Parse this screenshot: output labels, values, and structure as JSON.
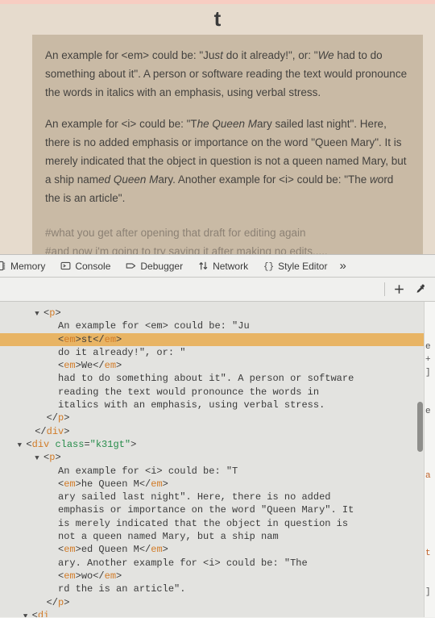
{
  "page": {
    "title": "t",
    "top_border_color": "#f7cdc2",
    "background_color": "#e6dbcd",
    "content_block_color": "#c9baa5",
    "paragraphs": [
      {
        "id": "p1",
        "segments": [
          {
            "text": "An example for <em> could be: \"Ju",
            "italic": false
          },
          {
            "text": "st",
            "italic": true
          },
          {
            "text": " do it already!\", or: \"",
            "italic": false
          },
          {
            "text": "We",
            "italic": true
          },
          {
            "text": " had to do something about it\". A person or software reading the text would pronounce the words in italics with an emphasis, using verbal stress.",
            "italic": false
          }
        ]
      },
      {
        "id": "p2",
        "segments": [
          {
            "text": "An example for <i> could be: \"T",
            "italic": false
          },
          {
            "text": "he Queen M",
            "italic": true
          },
          {
            "text": "ary sailed last night\". Here, there is no added emphasis or importance on the word \"Queen Mary\". It is merely indicated that the object in question is not a queen named Mary, but a ship nam",
            "italic": false
          },
          {
            "text": "ed Queen M",
            "italic": true
          },
          {
            "text": "ary. Another example for <i> could be: \"The ",
            "italic": false
          },
          {
            "text": "wo",
            "italic": true
          },
          {
            "text": "rd the is an article\".",
            "italic": false
          }
        ]
      }
    ],
    "hash_lines": [
      "#what you get after opening that draft for editing again",
      "#and now i'm going to try saving it after making no edits....."
    ]
  },
  "devtools": {
    "tabs": [
      {
        "label": "Memory",
        "icon": "memory-icon",
        "clipped": true
      },
      {
        "label": "Console",
        "icon": "console-icon",
        "clipped": false
      },
      {
        "label": "Debugger",
        "icon": "debugger-icon",
        "clipped": false
      },
      {
        "label": "Network",
        "icon": "network-icon",
        "clipped": false
      },
      {
        "label": "Style Editor",
        "icon": "style-editor-icon",
        "clipped": false
      }
    ],
    "more_tabs_label": "»",
    "toolbar": {
      "add_rule_label": "+",
      "eyedropper_label": "eyedropper"
    },
    "selected_color": "#e8b464",
    "markup_lines": [
      {
        "indent": 8,
        "twisty": true,
        "parts": [
          {
            "t": "punct",
            "v": "<"
          },
          {
            "t": "tag",
            "v": "p"
          },
          {
            "t": "punct",
            "v": ">"
          }
        ]
      },
      {
        "indent": 10,
        "twisty": false,
        "parts": [
          {
            "t": "txt",
            "v": "An example for <em> could be: \"Ju"
          }
        ]
      },
      {
        "indent": 10,
        "twisty": false,
        "selected": true,
        "parts": [
          {
            "t": "punct",
            "v": "<"
          },
          {
            "t": "tag",
            "v": "em"
          },
          {
            "t": "punct",
            "v": ">"
          },
          {
            "t": "txt",
            "v": "st"
          },
          {
            "t": "punct",
            "v": "</"
          },
          {
            "t": "tag",
            "v": "em"
          },
          {
            "t": "punct",
            "v": ">"
          }
        ]
      },
      {
        "indent": 10,
        "twisty": false,
        "parts": [
          {
            "t": "txt",
            "v": "do it already!\", or: \""
          }
        ]
      },
      {
        "indent": 10,
        "twisty": false,
        "parts": [
          {
            "t": "punct",
            "v": "<"
          },
          {
            "t": "tag",
            "v": "em"
          },
          {
            "t": "punct",
            "v": ">"
          },
          {
            "t": "txt",
            "v": "We"
          },
          {
            "t": "punct",
            "v": "</"
          },
          {
            "t": "tag",
            "v": "em"
          },
          {
            "t": "punct",
            "v": ">"
          }
        ]
      },
      {
        "indent": 10,
        "twisty": false,
        "parts": [
          {
            "t": "txt",
            "v": "had to do something about it\". A person or software"
          }
        ]
      },
      {
        "indent": 10,
        "twisty": false,
        "parts": [
          {
            "t": "txt",
            "v": "reading the text would pronounce the words in"
          }
        ]
      },
      {
        "indent": 10,
        "twisty": false,
        "parts": [
          {
            "t": "txt",
            "v": "italics with an emphasis, using verbal stress."
          }
        ]
      },
      {
        "indent": 8,
        "twisty": false,
        "parts": [
          {
            "t": "punct",
            "v": "</"
          },
          {
            "t": "tag",
            "v": "p"
          },
          {
            "t": "punct",
            "v": ">"
          }
        ]
      },
      {
        "indent": 6,
        "twisty": false,
        "parts": [
          {
            "t": "punct",
            "v": "</"
          },
          {
            "t": "tag",
            "v": "div"
          },
          {
            "t": "punct",
            "v": ">"
          }
        ]
      },
      {
        "indent": 5,
        "twisty": true,
        "parts": [
          {
            "t": "punct",
            "v": "<"
          },
          {
            "t": "tag",
            "v": "div"
          },
          {
            "t": "txt",
            "v": " "
          },
          {
            "t": "attr",
            "v": "class"
          },
          {
            "t": "punct",
            "v": "="
          },
          {
            "t": "attrval",
            "v": "\"k31gt\""
          },
          {
            "t": "punct",
            "v": ">"
          }
        ]
      },
      {
        "indent": 8,
        "twisty": true,
        "parts": [
          {
            "t": "punct",
            "v": "<"
          },
          {
            "t": "tag",
            "v": "p"
          },
          {
            "t": "punct",
            "v": ">"
          }
        ]
      },
      {
        "indent": 10,
        "twisty": false,
        "parts": [
          {
            "t": "txt",
            "v": "An example for <i> could be: \"T"
          }
        ]
      },
      {
        "indent": 10,
        "twisty": false,
        "parts": [
          {
            "t": "punct",
            "v": "<"
          },
          {
            "t": "tag",
            "v": "em"
          },
          {
            "t": "punct",
            "v": ">"
          },
          {
            "t": "txt",
            "v": "he Queen M"
          },
          {
            "t": "punct",
            "v": "</"
          },
          {
            "t": "tag",
            "v": "em"
          },
          {
            "t": "punct",
            "v": ">"
          }
        ]
      },
      {
        "indent": 10,
        "twisty": false,
        "parts": [
          {
            "t": "txt",
            "v": "ary sailed last night\". Here, there is no added"
          }
        ]
      },
      {
        "indent": 10,
        "twisty": false,
        "parts": [
          {
            "t": "txt",
            "v": "emphasis or importance on the word \"Queen Mary\". It"
          }
        ]
      },
      {
        "indent": 10,
        "twisty": false,
        "parts": [
          {
            "t": "txt",
            "v": "is merely indicated that the object in question is"
          }
        ]
      },
      {
        "indent": 10,
        "twisty": false,
        "parts": [
          {
            "t": "txt",
            "v": "not a queen named Mary, but a ship nam"
          }
        ]
      },
      {
        "indent": 10,
        "twisty": false,
        "parts": [
          {
            "t": "punct",
            "v": "<"
          },
          {
            "t": "tag",
            "v": "em"
          },
          {
            "t": "punct",
            "v": ">"
          },
          {
            "t": "txt",
            "v": "ed Queen M"
          },
          {
            "t": "punct",
            "v": "</"
          },
          {
            "t": "tag",
            "v": "em"
          },
          {
            "t": "punct",
            "v": ">"
          }
        ]
      },
      {
        "indent": 10,
        "twisty": false,
        "parts": [
          {
            "t": "txt",
            "v": "ary. Another example for <i> could be: \"The"
          }
        ]
      },
      {
        "indent": 10,
        "twisty": false,
        "parts": [
          {
            "t": "punct",
            "v": "<"
          },
          {
            "t": "tag",
            "v": "em"
          },
          {
            "t": "punct",
            "v": ">"
          },
          {
            "t": "txt",
            "v": "wo"
          },
          {
            "t": "punct",
            "v": "</"
          },
          {
            "t": "tag",
            "v": "em"
          },
          {
            "t": "punct",
            "v": ">"
          }
        ]
      },
      {
        "indent": 10,
        "twisty": false,
        "parts": [
          {
            "t": "txt",
            "v": "rd the is an article\"."
          }
        ]
      },
      {
        "indent": 8,
        "twisty": false,
        "parts": [
          {
            "t": "punct",
            "v": "</"
          },
          {
            "t": "tag",
            "v": "p"
          },
          {
            "t": "punct",
            "v": ">"
          }
        ]
      },
      {
        "indent": 6,
        "twisty": true,
        "parts": [
          {
            "t": "punct",
            "v": "<"
          },
          {
            "t": "tag",
            "v": "di"
          }
        ]
      }
    ],
    "rules_sliver_lines": [
      {
        "text": "",
        "orange": false
      },
      {
        "text": "",
        "orange": false
      },
      {
        "text": "",
        "orange": false
      },
      {
        "text": "e",
        "orange": false
      },
      {
        "text": "+",
        "orange": false
      },
      {
        "text": "]",
        "orange": false
      },
      {
        "text": "",
        "orange": false
      },
      {
        "text": "",
        "orange": false
      },
      {
        "text": "e",
        "orange": false
      },
      {
        "text": "",
        "orange": false
      },
      {
        "text": "",
        "orange": false
      },
      {
        "text": "",
        "orange": false
      },
      {
        "text": "",
        "orange": false
      },
      {
        "text": "a",
        "orange": true
      },
      {
        "text": "",
        "orange": false
      },
      {
        "text": "",
        "orange": false
      },
      {
        "text": "",
        "orange": false
      },
      {
        "text": "",
        "orange": false
      },
      {
        "text": "",
        "orange": false
      },
      {
        "text": "t",
        "orange": true
      },
      {
        "text": "",
        "orange": false
      },
      {
        "text": "",
        "orange": false
      },
      {
        "text": "]",
        "orange": false
      }
    ]
  }
}
